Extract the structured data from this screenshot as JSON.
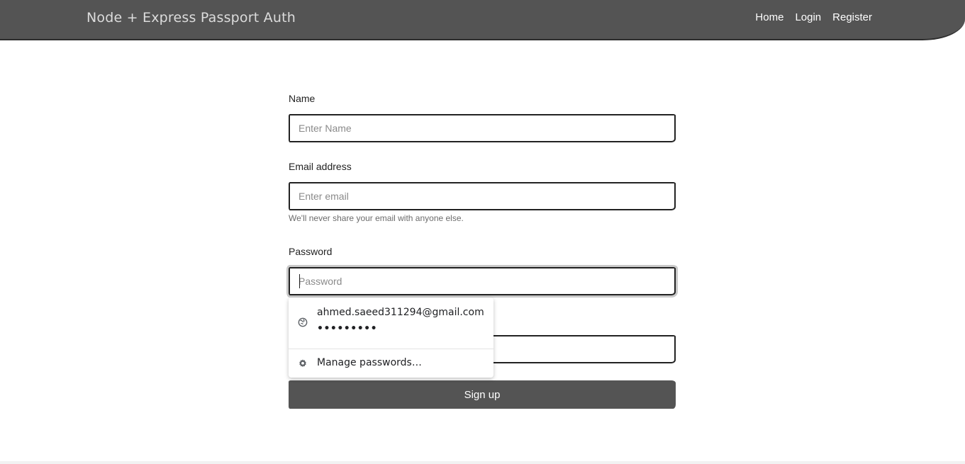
{
  "navbar": {
    "brand": "Node + Express Passport Auth",
    "links": [
      {
        "label": "Home"
      },
      {
        "label": "Login"
      },
      {
        "label": "Register"
      }
    ]
  },
  "form": {
    "name": {
      "label": "Name",
      "placeholder": "Enter Name",
      "value": ""
    },
    "email": {
      "label": "Email address",
      "placeholder": "Enter email",
      "value": "",
      "help": "We'll never share your email with anyone else."
    },
    "password": {
      "label": "Password",
      "placeholder": "Password",
      "value": ""
    },
    "confirm": {
      "placeholder": "",
      "value": ""
    },
    "submit_label": "Sign up"
  },
  "autofill": {
    "account_email": "ahmed.saeed311294@gmail.com",
    "masked_password": "•••••••••",
    "manage_label": "Manage passwords…"
  },
  "colors": {
    "navbar_bg": "#545454",
    "button_bg": "#545454"
  }
}
